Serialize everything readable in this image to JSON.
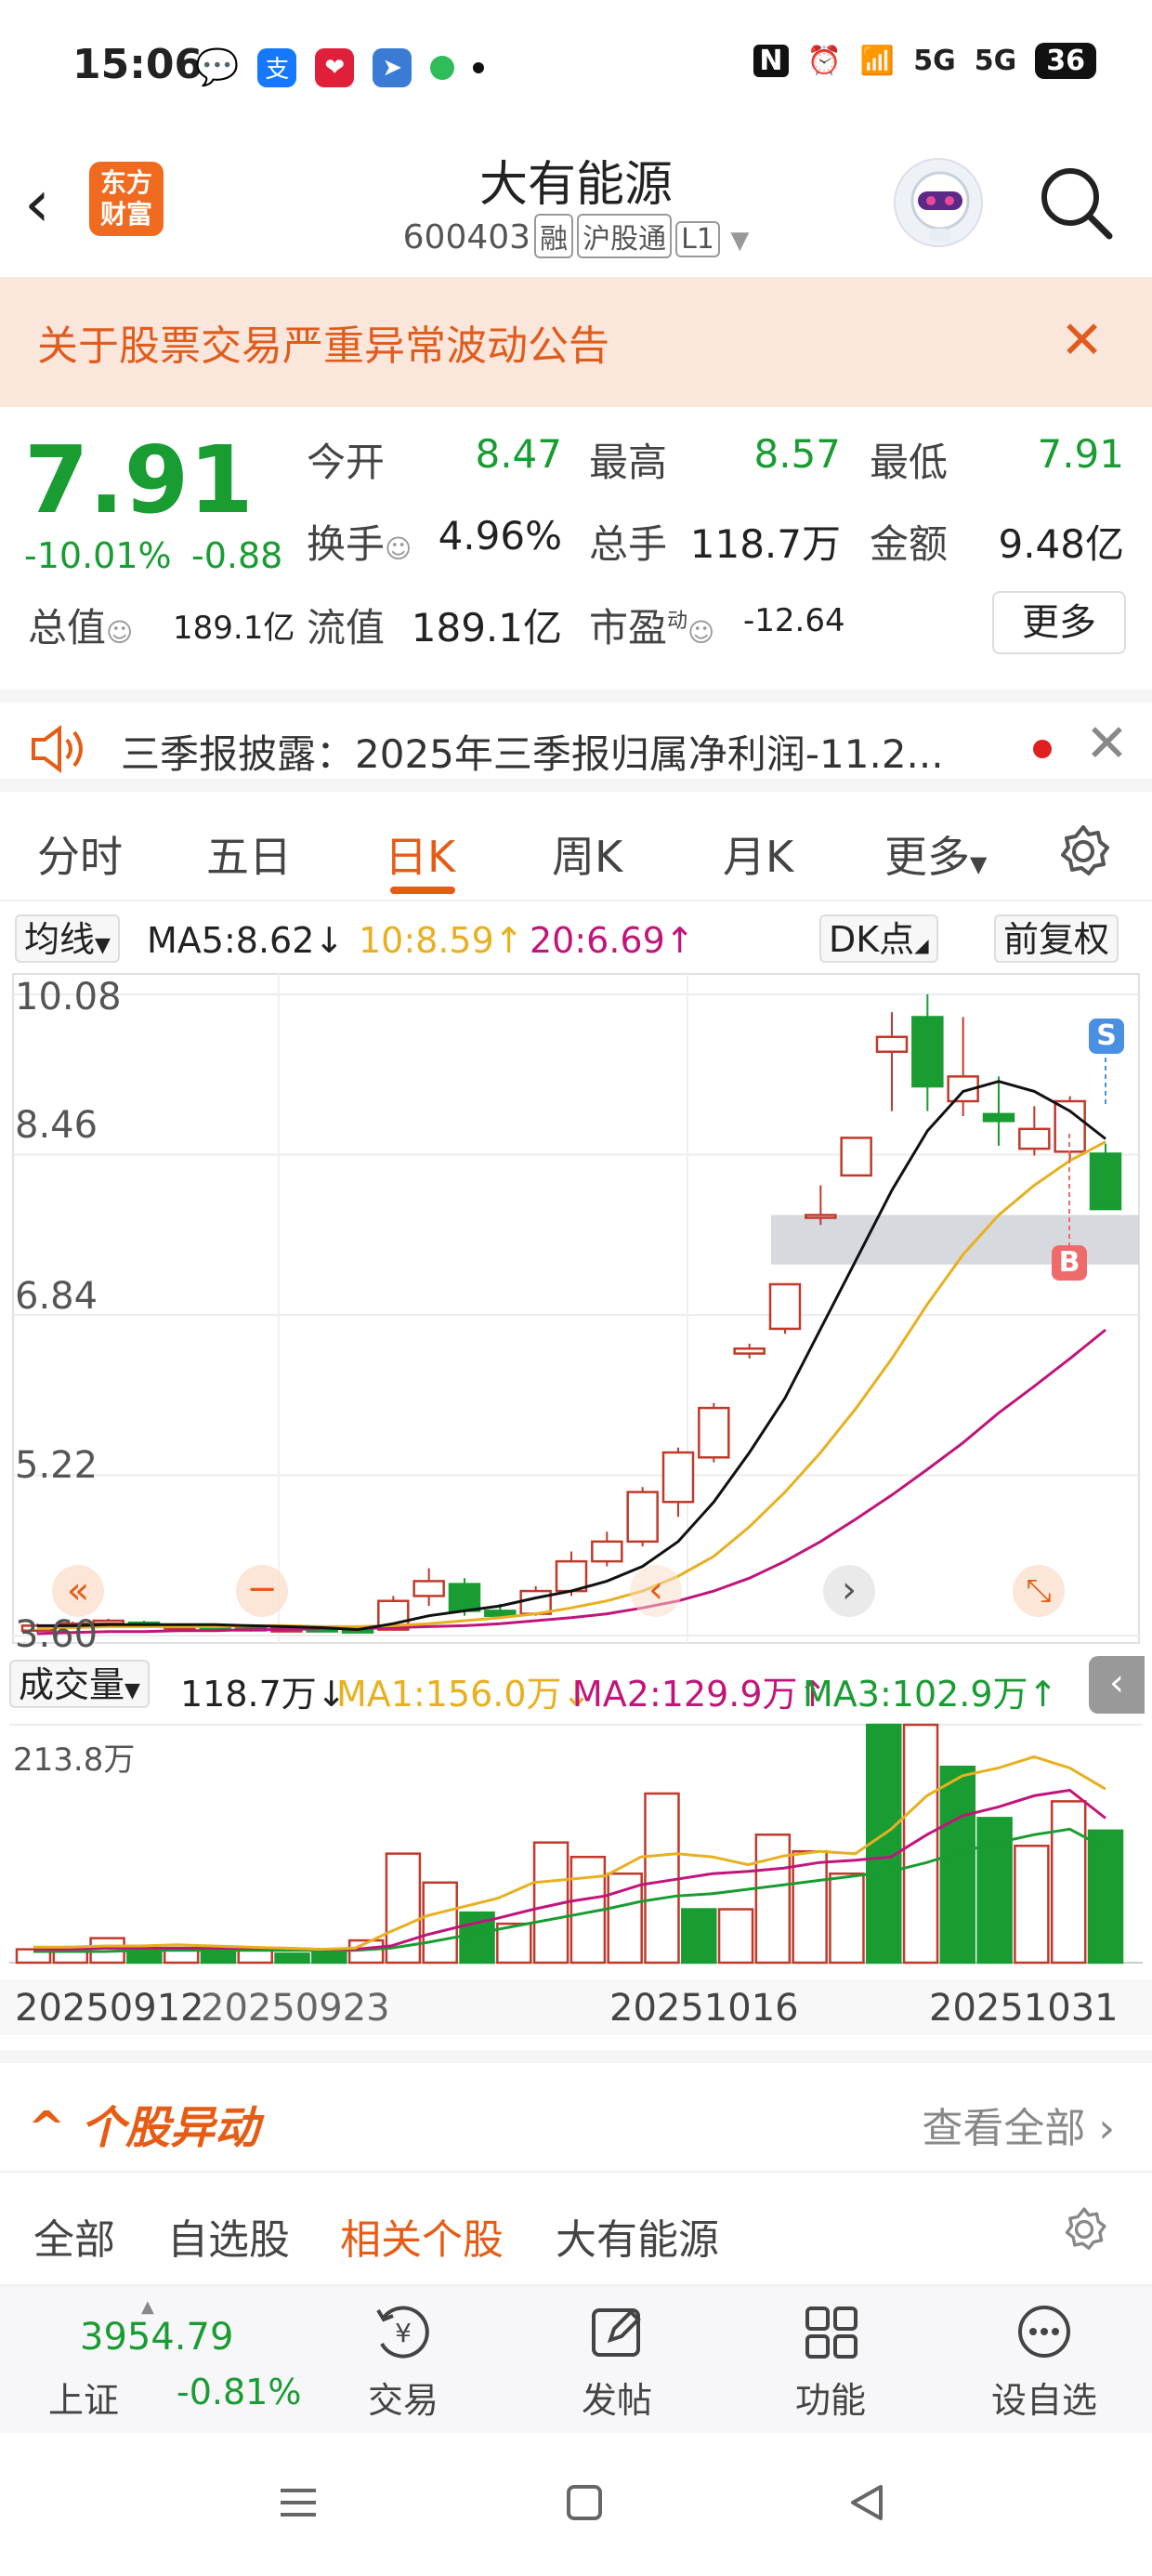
{
  "status_bar": {
    "time": "15:06",
    "battery": "36",
    "signal1": "5G",
    "signal2": "5G",
    "app_icon_alipay": "支"
  },
  "header": {
    "app_logo": "东方\n财富",
    "stock_name": "大有能源",
    "stock_code": "600403",
    "tags": [
      "融",
      "沪股通",
      "L1"
    ]
  },
  "notice": {
    "text": "关于股票交易严重异常波动公告"
  },
  "quote": {
    "price": "7.91",
    "change_pct": "-10.01%",
    "change_abs": "-0.88",
    "open_label": "今开",
    "open": "8.47",
    "high_label": "最高",
    "high": "8.57",
    "low_label": "最低",
    "low": "7.91",
    "turnover_label": "换手",
    "turnover": "4.96%",
    "volume_label": "总手",
    "volume": "118.7万",
    "amount_label": "金额",
    "amount": "9.48亿",
    "mktcap_label": "总值",
    "mktcap": "189.1亿",
    "float_label": "流值",
    "float_cap": "189.1亿",
    "pe_label": "市盈",
    "pe_sup": "动",
    "pe": "-12.64",
    "more_label": "更多"
  },
  "disclosure": {
    "text": "三季报披露：2025年三季报归属净利润-11.2..."
  },
  "tabs": [
    {
      "label": "分时"
    },
    {
      "label": "五日"
    },
    {
      "label": "日K"
    },
    {
      "label": "周K"
    },
    {
      "label": "月K"
    },
    {
      "label": "更多"
    }
  ],
  "ma_bar": {
    "selector": "均线",
    "ma5": "MA5:8.62",
    "ma10": "10:8.59",
    "ma20": "20:6.69",
    "dk": "DK点",
    "fuquan": "前复权"
  },
  "chart_y_ticks": [
    "10.08",
    "8.46",
    "6.84",
    "5.22",
    "3.60"
  ],
  "markers": {
    "sell": "S",
    "buy": "B"
  },
  "vol_bar": {
    "selector": "成交量",
    "vol": "118.7万",
    "ma1": "MA1:156.0万",
    "ma2": "MA2:129.9万",
    "ma3": "MA3:102.9万",
    "max_label": "213.8万"
  },
  "dates": [
    "20250912",
    "20250923",
    "20251016",
    "20251031"
  ],
  "section": {
    "title": "个股异动",
    "view_all": "查看全部"
  },
  "sub_tabs": [
    {
      "label": "全部"
    },
    {
      "label": "自选股"
    },
    {
      "label": "相关个股"
    },
    {
      "label": "大有能源"
    }
  ],
  "bottom": {
    "index_value": "3954.79",
    "index_name": "上证",
    "index_pct": "-0.81%",
    "items": [
      {
        "label": "交易"
      },
      {
        "label": "发帖"
      },
      {
        "label": "功能"
      },
      {
        "label": "设自选"
      }
    ]
  },
  "colors": {
    "up": "#c0392b",
    "down": "#199c32",
    "accent": "#e65c14",
    "ma5": "#111111",
    "ma10": "#e8b020",
    "ma20": "#c0157a"
  },
  "chart_data": {
    "type": "candlestick",
    "ylim": [
      3.6,
      10.08
    ],
    "yticks": [
      10.08,
      8.46,
      6.84,
      5.22,
      3.6
    ],
    "x_labels": [
      "20250912",
      "20250923",
      "20251016",
      "20251031"
    ],
    "candles": [
      {
        "o": 3.65,
        "c": 3.7,
        "h": 3.72,
        "l": 3.63
      },
      {
        "o": 3.7,
        "c": 3.72,
        "h": 3.74,
        "l": 3.68
      },
      {
        "o": 3.72,
        "c": 3.75,
        "h": 3.77,
        "l": 3.7
      },
      {
        "o": 3.73,
        "c": 3.7,
        "h": 3.75,
        "l": 3.68
      },
      {
        "o": 3.7,
        "c": 3.7,
        "h": 3.72,
        "l": 3.68
      },
      {
        "o": 3.7,
        "c": 3.68,
        "h": 3.71,
        "l": 3.66
      },
      {
        "o": 3.68,
        "c": 3.66,
        "h": 3.7,
        "l": 3.64
      },
      {
        "o": 3.66,
        "c": 3.67,
        "h": 3.69,
        "l": 3.64
      },
      {
        "o": 3.67,
        "c": 3.66,
        "h": 3.68,
        "l": 3.64
      },
      {
        "o": 3.66,
        "c": 3.65,
        "h": 3.68,
        "l": 3.63
      },
      {
        "o": 3.66,
        "c": 3.95,
        "h": 4.0,
        "l": 3.65
      },
      {
        "o": 4.0,
        "c": 4.15,
        "h": 4.28,
        "l": 3.9
      },
      {
        "o": 4.12,
        "c": 3.85,
        "h": 4.18,
        "l": 3.8
      },
      {
        "o": 3.85,
        "c": 3.8,
        "h": 3.92,
        "l": 3.78
      },
      {
        "o": 3.82,
        "c": 4.05,
        "h": 4.1,
        "l": 3.8
      },
      {
        "o": 4.05,
        "c": 4.35,
        "h": 4.45,
        "l": 4.0
      },
      {
        "o": 4.35,
        "c": 4.55,
        "h": 4.65,
        "l": 4.3
      },
      {
        "o": 4.55,
        "c": 5.05,
        "h": 5.1,
        "l": 4.5
      },
      {
        "o": 4.95,
        "c": 5.45,
        "h": 5.5,
        "l": 4.8
      },
      {
        "o": 5.4,
        "c": 5.9,
        "h": 5.95,
        "l": 5.35
      },
      {
        "o": 6.45,
        "c": 6.5,
        "h": 6.55,
        "l": 6.4
      },
      {
        "o": 6.7,
        "c": 7.15,
        "h": 7.15,
        "l": 6.65
      },
      {
        "o": 7.85,
        "c": 7.85,
        "h": 8.15,
        "l": 7.75
      },
      {
        "o": 8.25,
        "c": 8.63,
        "h": 8.63,
        "l": 8.25
      },
      {
        "o": 9.5,
        "c": 9.65,
        "h": 9.9,
        "l": 8.9
      },
      {
        "o": 9.85,
        "c": 9.15,
        "h": 10.08,
        "l": 8.9
      },
      {
        "o": 9.0,
        "c": 9.25,
        "h": 9.85,
        "l": 8.85
      },
      {
        "o": 8.87,
        "c": 8.8,
        "h": 9.25,
        "l": 8.55
      },
      {
        "o": 8.52,
        "c": 8.72,
        "h": 8.95,
        "l": 8.45
      },
      {
        "o": 8.49,
        "c": 9.0,
        "h": 9.05,
        "l": 8.4
      },
      {
        "o": 8.47,
        "c": 7.91,
        "h": 8.57,
        "l": 7.91
      }
    ],
    "ma5": [
      3.7,
      3.7,
      3.71,
      3.71,
      3.71,
      3.71,
      3.7,
      3.69,
      3.68,
      3.66,
      3.72,
      3.8,
      3.85,
      3.9,
      3.98,
      4.05,
      4.15,
      4.3,
      4.55,
      4.95,
      5.45,
      6.0,
      6.7,
      7.4,
      8.1,
      8.7,
      9.1,
      9.2,
      9.1,
      8.9,
      8.62
    ],
    "ma10": [
      3.68,
      3.68,
      3.69,
      3.69,
      3.69,
      3.69,
      3.7,
      3.7,
      3.69,
      3.69,
      3.7,
      3.72,
      3.75,
      3.78,
      3.82,
      3.88,
      3.95,
      4.05,
      4.2,
      4.4,
      4.7,
      5.05,
      5.45,
      5.9,
      6.4,
      6.95,
      7.45,
      7.85,
      8.15,
      8.4,
      8.59
    ],
    "ma20": [
      3.62,
      3.63,
      3.64,
      3.64,
      3.65,
      3.65,
      3.66,
      3.66,
      3.67,
      3.67,
      3.68,
      3.69,
      3.7,
      3.72,
      3.75,
      3.78,
      3.82,
      3.88,
      3.95,
      4.05,
      4.18,
      4.35,
      4.55,
      4.78,
      5.02,
      5.28,
      5.55,
      5.85,
      6.12,
      6.4,
      6.69
    ],
    "volume": {
      "ylim": [
        0,
        213.8
      ],
      "unit": "万",
      "bars": [
        {
          "v": 12,
          "up": true
        },
        {
          "v": 14,
          "up": true
        },
        {
          "v": 22,
          "up": true
        },
        {
          "v": 10,
          "up": false
        },
        {
          "v": 12,
          "up": true
        },
        {
          "v": 14,
          "up": false
        },
        {
          "v": 12,
          "up": true
        },
        {
          "v": 8,
          "up": false
        },
        {
          "v": 10,
          "up": false
        },
        {
          "v": 20,
          "up": true
        },
        {
          "v": 98,
          "up": true
        },
        {
          "v": 72,
          "up": true
        },
        {
          "v": 45,
          "up": false
        },
        {
          "v": 35,
          "up": true
        },
        {
          "v": 108,
          "up": true
        },
        {
          "v": 95,
          "up": true
        },
        {
          "v": 80,
          "up": true
        },
        {
          "v": 152,
          "up": true
        },
        {
          "v": 48,
          "up": false
        },
        {
          "v": 48,
          "up": true
        },
        {
          "v": 115,
          "up": true
        },
        {
          "v": 100,
          "up": true
        },
        {
          "v": 80,
          "up": true
        },
        {
          "v": 213.8,
          "up": false
        },
        {
          "v": 213.8,
          "up": true
        },
        {
          "v": 176,
          "up": false
        },
        {
          "v": 130,
          "up": false
        },
        {
          "v": 105,
          "up": true
        },
        {
          "v": 145,
          "up": true
        },
        {
          "v": 118.7,
          "up": false
        }
      ],
      "ma1": [
        14,
        14,
        15,
        15,
        16,
        15,
        14,
        13,
        12,
        13,
        28,
        42,
        50,
        58,
        72,
        75,
        78,
        95,
        98,
        95,
        88,
        96,
        100,
        98,
        120,
        150,
        168,
        175,
        185,
        175,
        156
      ],
      "ma2": [
        12,
        12,
        13,
        13,
        13,
        13,
        13,
        13,
        12,
        12,
        15,
        25,
        33,
        40,
        48,
        55,
        60,
        70,
        75,
        80,
        82,
        85,
        90,
        92,
        95,
        115,
        132,
        140,
        150,
        155,
        129.9
      ],
      "ma3": [
        10,
        10,
        10,
        11,
        11,
        11,
        11,
        11,
        11,
        11,
        13,
        18,
        24,
        30,
        36,
        42,
        48,
        55,
        60,
        62,
        66,
        70,
        74,
        78,
        82,
        90,
        100,
        108,
        115,
        120,
        102.9
      ]
    }
  }
}
